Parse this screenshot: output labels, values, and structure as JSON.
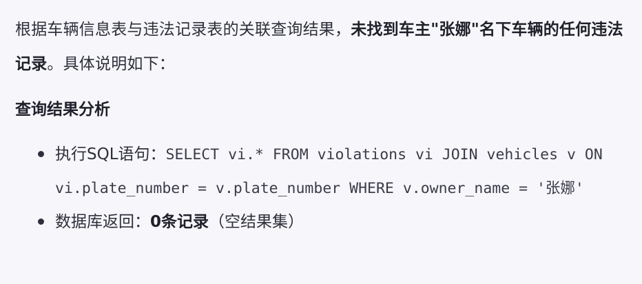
{
  "intro": {
    "text_before": "根据车辆信息表与违法记录表的关联查询结果，",
    "text_bold": "未找到车主\"张娜\"名下车辆的任何违法记录",
    "text_after": "。具体说明如下："
  },
  "section": {
    "title": "查询结果分析"
  },
  "bullets": [
    {
      "label": "执行SQL语句：",
      "code": "SELECT vi.* FROM violations vi JOIN vehicles v ON vi.plate_number = v.plate_number WHERE v.owner_name = '张娜'"
    },
    {
      "label": "数据库返回：",
      "bold": "0条记录",
      "note": "（空结果集）"
    }
  ]
}
